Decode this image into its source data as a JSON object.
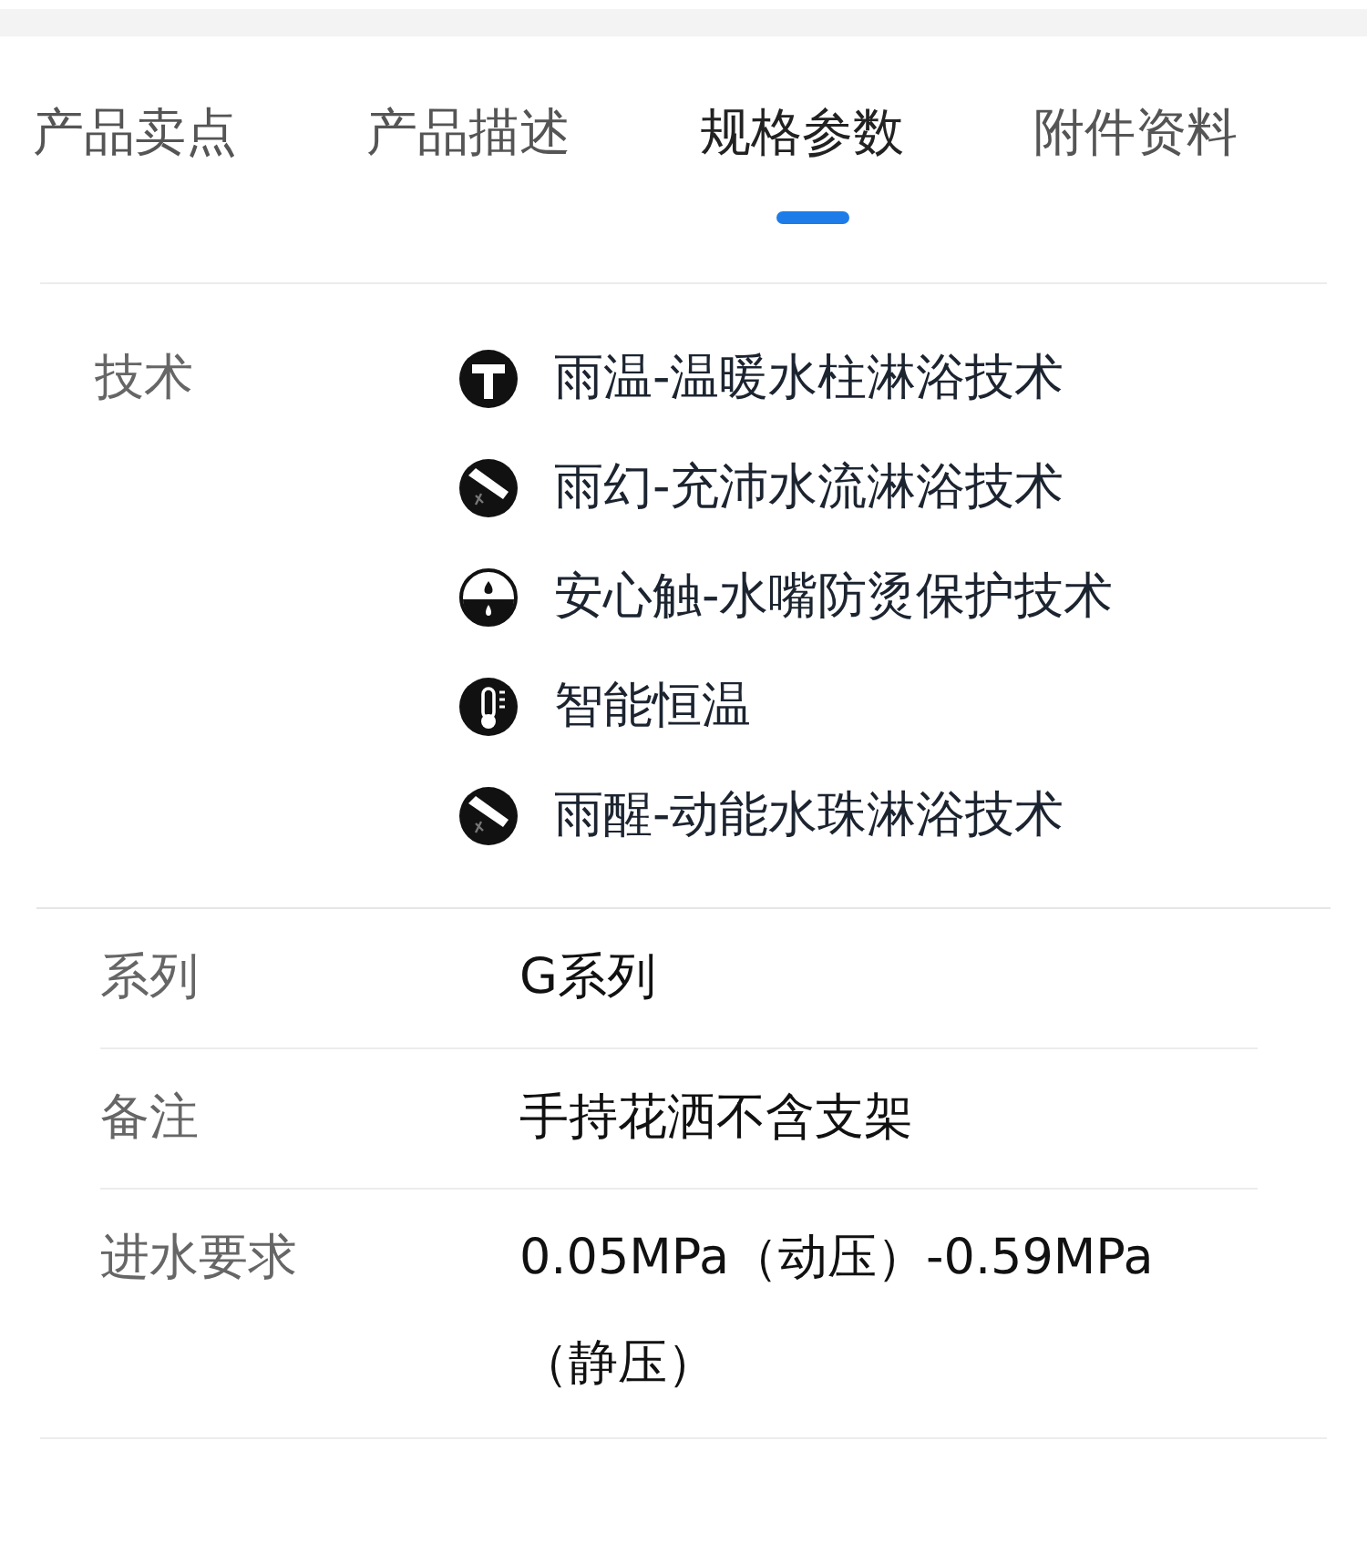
{
  "tabs": [
    {
      "label": "产品卖点",
      "selected": false
    },
    {
      "label": "产品描述",
      "selected": false
    },
    {
      "label": "规格参数",
      "selected": true
    },
    {
      "label": "附件资料",
      "selected": false
    }
  ],
  "technology": {
    "label": "技术",
    "items": [
      {
        "kind": "heating",
        "text": "雨温-温暖水柱淋浴技术"
      },
      {
        "kind": "shower",
        "text": "雨幻-充沛水流淋浴技术"
      },
      {
        "kind": "safety",
        "text": "安心触-水嘴防烫保护技术"
      },
      {
        "kind": "thermostat",
        "text": "智能恒温"
      },
      {
        "kind": "shower",
        "text": "雨醒-动能水珠淋浴技术"
      }
    ]
  },
  "specs": [
    {
      "label": "系列",
      "value": "G系列"
    },
    {
      "label": "备注",
      "value": "手持花洒不含支架"
    },
    {
      "label": "进水要求",
      "value": "0.05MPa（动压）-0.59MPa（静压）"
    }
  ]
}
